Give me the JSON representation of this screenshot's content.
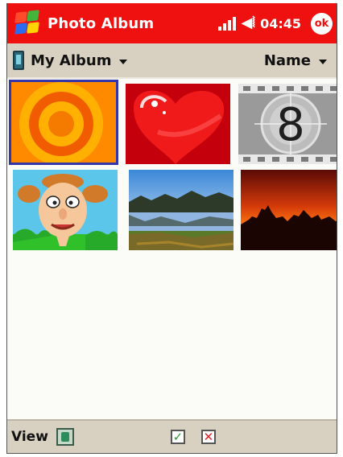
{
  "titlebar": {
    "title": "Photo Album",
    "time": "04:45",
    "ok_label": "ok",
    "accent": "#ef1010"
  },
  "albumbar": {
    "album_name": "My Album",
    "sort_label": "Name"
  },
  "thumbnails": [
    {
      "name": "orange-circles",
      "selected": true
    },
    {
      "name": "red-heart",
      "selected": false
    },
    {
      "name": "film-countdown-8",
      "label": "8",
      "selected": false
    },
    {
      "name": "cartoon-face",
      "selected": false
    },
    {
      "name": "lake-mountains",
      "selected": false
    },
    {
      "name": "sunset-silhouette",
      "selected": false
    }
  ],
  "bottombar": {
    "view_label": "View"
  },
  "icons": [
    "windows-start-icon",
    "signal-icon",
    "volume-icon",
    "album-icon",
    "view-icon",
    "check-icon",
    "delete-icon"
  ]
}
